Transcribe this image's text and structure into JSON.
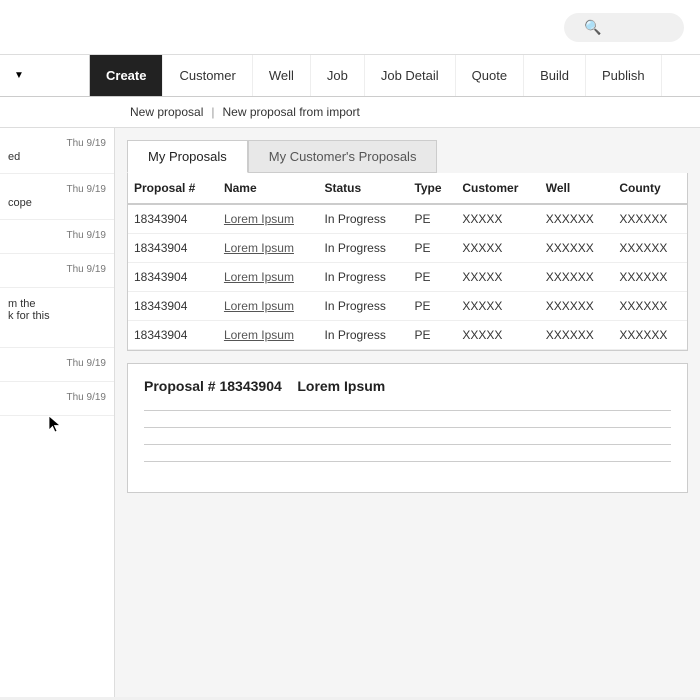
{
  "topbar": {
    "search_placeholder": "Search"
  },
  "nav": {
    "dropdown_label": "",
    "tabs": [
      {
        "label": "Create",
        "active": true
      },
      {
        "label": "Customer",
        "active": false
      },
      {
        "label": "Well",
        "active": false
      },
      {
        "label": "Job",
        "active": false
      },
      {
        "label": "Job Detail",
        "active": false
      },
      {
        "label": "Quote",
        "active": false
      },
      {
        "label": "Build",
        "active": false
      },
      {
        "label": "Publish",
        "active": false
      }
    ]
  },
  "subnav": {
    "new_proposal": "New proposal",
    "separator": "|",
    "new_from_import": "New proposal from import"
  },
  "sidebar": {
    "items": [
      {
        "date": "Thu 9/19",
        "text": "ed"
      },
      {
        "date": "Thu 9/19",
        "text": "cope"
      },
      {
        "date": "Thu 9/19",
        "text": ""
      },
      {
        "date": "Thu 9/19",
        "text": ""
      },
      {
        "date": "",
        "text": "m the\nk for this"
      },
      {
        "date": "Thu 9/19",
        "text": ""
      },
      {
        "date": "Thu 9/19",
        "text": ""
      }
    ]
  },
  "proposals": {
    "tabs": [
      {
        "label": "My Proposals",
        "active": true
      },
      {
        "label": "My Customer's Proposals",
        "active": false
      }
    ],
    "columns": [
      "Proposal #",
      "Name",
      "Status",
      "Type",
      "Customer",
      "Well",
      "County"
    ],
    "rows": [
      {
        "proposal": "18343904",
        "name": "Lorem Ipsum",
        "status": "In Progress",
        "type": "PE",
        "customer": "XXXXX",
        "well": "XXXXXX",
        "county": "XXXXXX"
      },
      {
        "proposal": "18343904",
        "name": "Lorem Ipsum",
        "status": "In Progress",
        "type": "PE",
        "customer": "XXXXX",
        "well": "XXXXXX",
        "county": "XXXXXX"
      },
      {
        "proposal": "18343904",
        "name": "Lorem Ipsum",
        "status": "In Progress",
        "type": "PE",
        "customer": "XXXXX",
        "well": "XXXXXX",
        "county": "XXXXXX"
      },
      {
        "proposal": "18343904",
        "name": "Lorem Ipsum",
        "status": "In Progress",
        "type": "PE",
        "customer": "XXXXX",
        "well": "XXXXXX",
        "county": "XXXXXX"
      },
      {
        "proposal": "18343904",
        "name": "Lorem Ipsum",
        "status": "In Progress",
        "type": "PE",
        "customer": "XXXXX",
        "well": "XXXXXX",
        "county": "XXXXXX"
      }
    ]
  },
  "detail": {
    "label_proposal": "Proposal #",
    "proposal_number": "18343904",
    "proposal_name": "Lorem Ipsum",
    "lines": 4
  },
  "colors": {
    "active_tab_bg": "#222222",
    "active_tab_text": "#ffffff"
  }
}
